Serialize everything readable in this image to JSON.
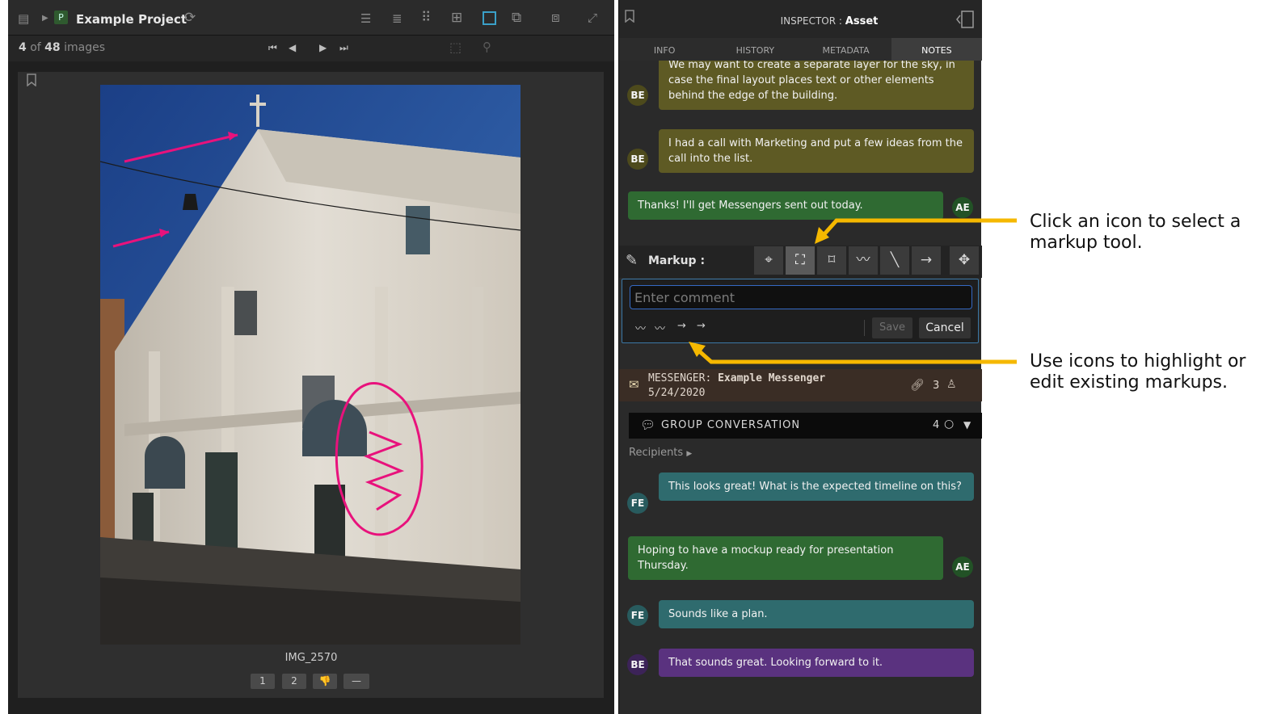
{
  "viewer": {
    "project_badge": "P",
    "project_title": "Example Project",
    "count_current": "4",
    "count_of": "of",
    "count_total": "48",
    "count_unit": "images",
    "filename": "IMG_2570",
    "rating_buttons": [
      "1",
      "2",
      "👎",
      "—"
    ]
  },
  "inspector": {
    "title_prefix": "INSPECTOR :",
    "title_value": "Asset",
    "tabs": [
      "INFO",
      "HISTORY",
      "METADATA",
      "NOTES"
    ],
    "active_tab": "NOTES",
    "messages_top": [
      {
        "author": "BE",
        "text": "We may want to create a separate layer for the sky, in case the final layout places text or other elements behind the edge of the building."
      },
      {
        "author": "BE",
        "text": "I had a call with Marketing and put a few ideas from the call into the list."
      },
      {
        "author": "AE",
        "text": "Thanks! I'll get Messengers sent out today."
      }
    ],
    "markup": {
      "label": "Markup :",
      "comment_placeholder": "Enter comment",
      "save_label": "Save",
      "cancel_label": "Cancel"
    },
    "messenger": {
      "label_prefix": "MESSENGER:",
      "name": "Example Messenger",
      "date": "5/24/2020",
      "count": "3"
    },
    "group": {
      "label": "GROUP CONVERSATION",
      "count": "4",
      "recipients_label": "Recipients"
    },
    "messages_group": [
      {
        "author": "FE",
        "text": "This looks great! What is the expected timeline on this?"
      },
      {
        "author": "AE",
        "text": "Hoping to have a mockup ready for presentation Thursday."
      },
      {
        "author": "FE",
        "text": "Sounds like a plan."
      },
      {
        "author": "BE",
        "text": "That sounds great. Looking forward to it."
      }
    ]
  },
  "annotations": {
    "select_tool": "Click an icon to select a markup tool.",
    "edit_markups": "Use icons to highlight or edit existing markups."
  },
  "colors": {
    "accent_arrow": "#f5b800",
    "markup_pink": "#e8127c",
    "bubble_olive": "#5e5a24",
    "bubble_green": "#2f6a32",
    "bubble_teal": "#2f6b6e",
    "bubble_purple": "#5a327f"
  }
}
